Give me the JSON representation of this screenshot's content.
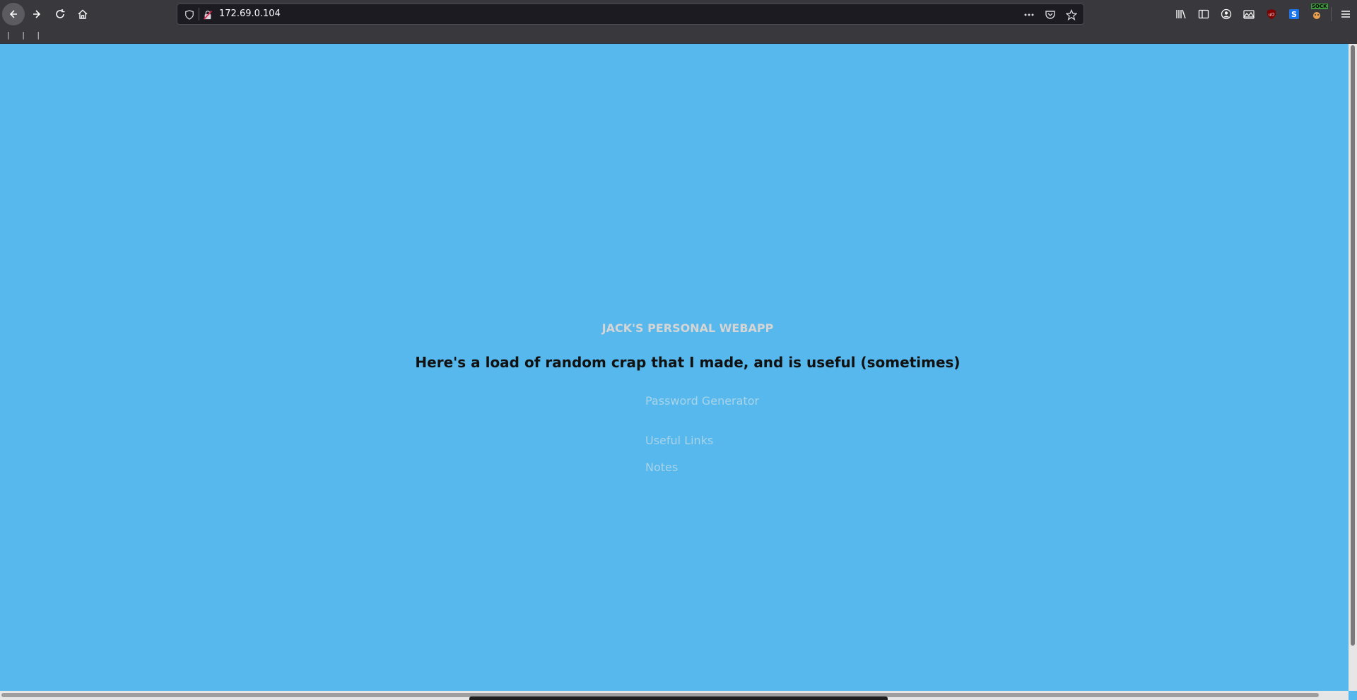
{
  "browser": {
    "url": "172.69.0.104",
    "bookmarks_text": "| | |",
    "extension_badge": "SOCK",
    "icons": {
      "back": "back-arrow-icon",
      "forward": "forward-arrow-icon",
      "reload": "reload-icon",
      "home": "home-icon",
      "shield": "tracking-shield-icon",
      "insecure": "insecure-lock-icon",
      "more": "more-actions-icon",
      "pocket": "pocket-icon",
      "bookmark": "bookmark-star-icon",
      "library": "library-icon",
      "sidebar": "sidebar-icon",
      "account": "account-icon",
      "screenshot": "screenshot-icon",
      "ublock": "ublock-icon",
      "s_ext": "s-extension-icon",
      "sock_ext": "sock-extension-icon",
      "menu": "hamburger-menu-icon"
    }
  },
  "page": {
    "app_title": "JACK'S PERSONAL WEBAPP",
    "tagline": "Here's a load of random crap that I made, and is useful (sometimes)",
    "links": [
      {
        "label": "Password Generator"
      },
      {
        "label": "Useful Links"
      },
      {
        "label": "Notes"
      }
    ],
    "colors": {
      "background": "#56b8ec",
      "title": "#d5d5d5",
      "tagline": "#111111",
      "link": "#a8d4ea"
    }
  }
}
